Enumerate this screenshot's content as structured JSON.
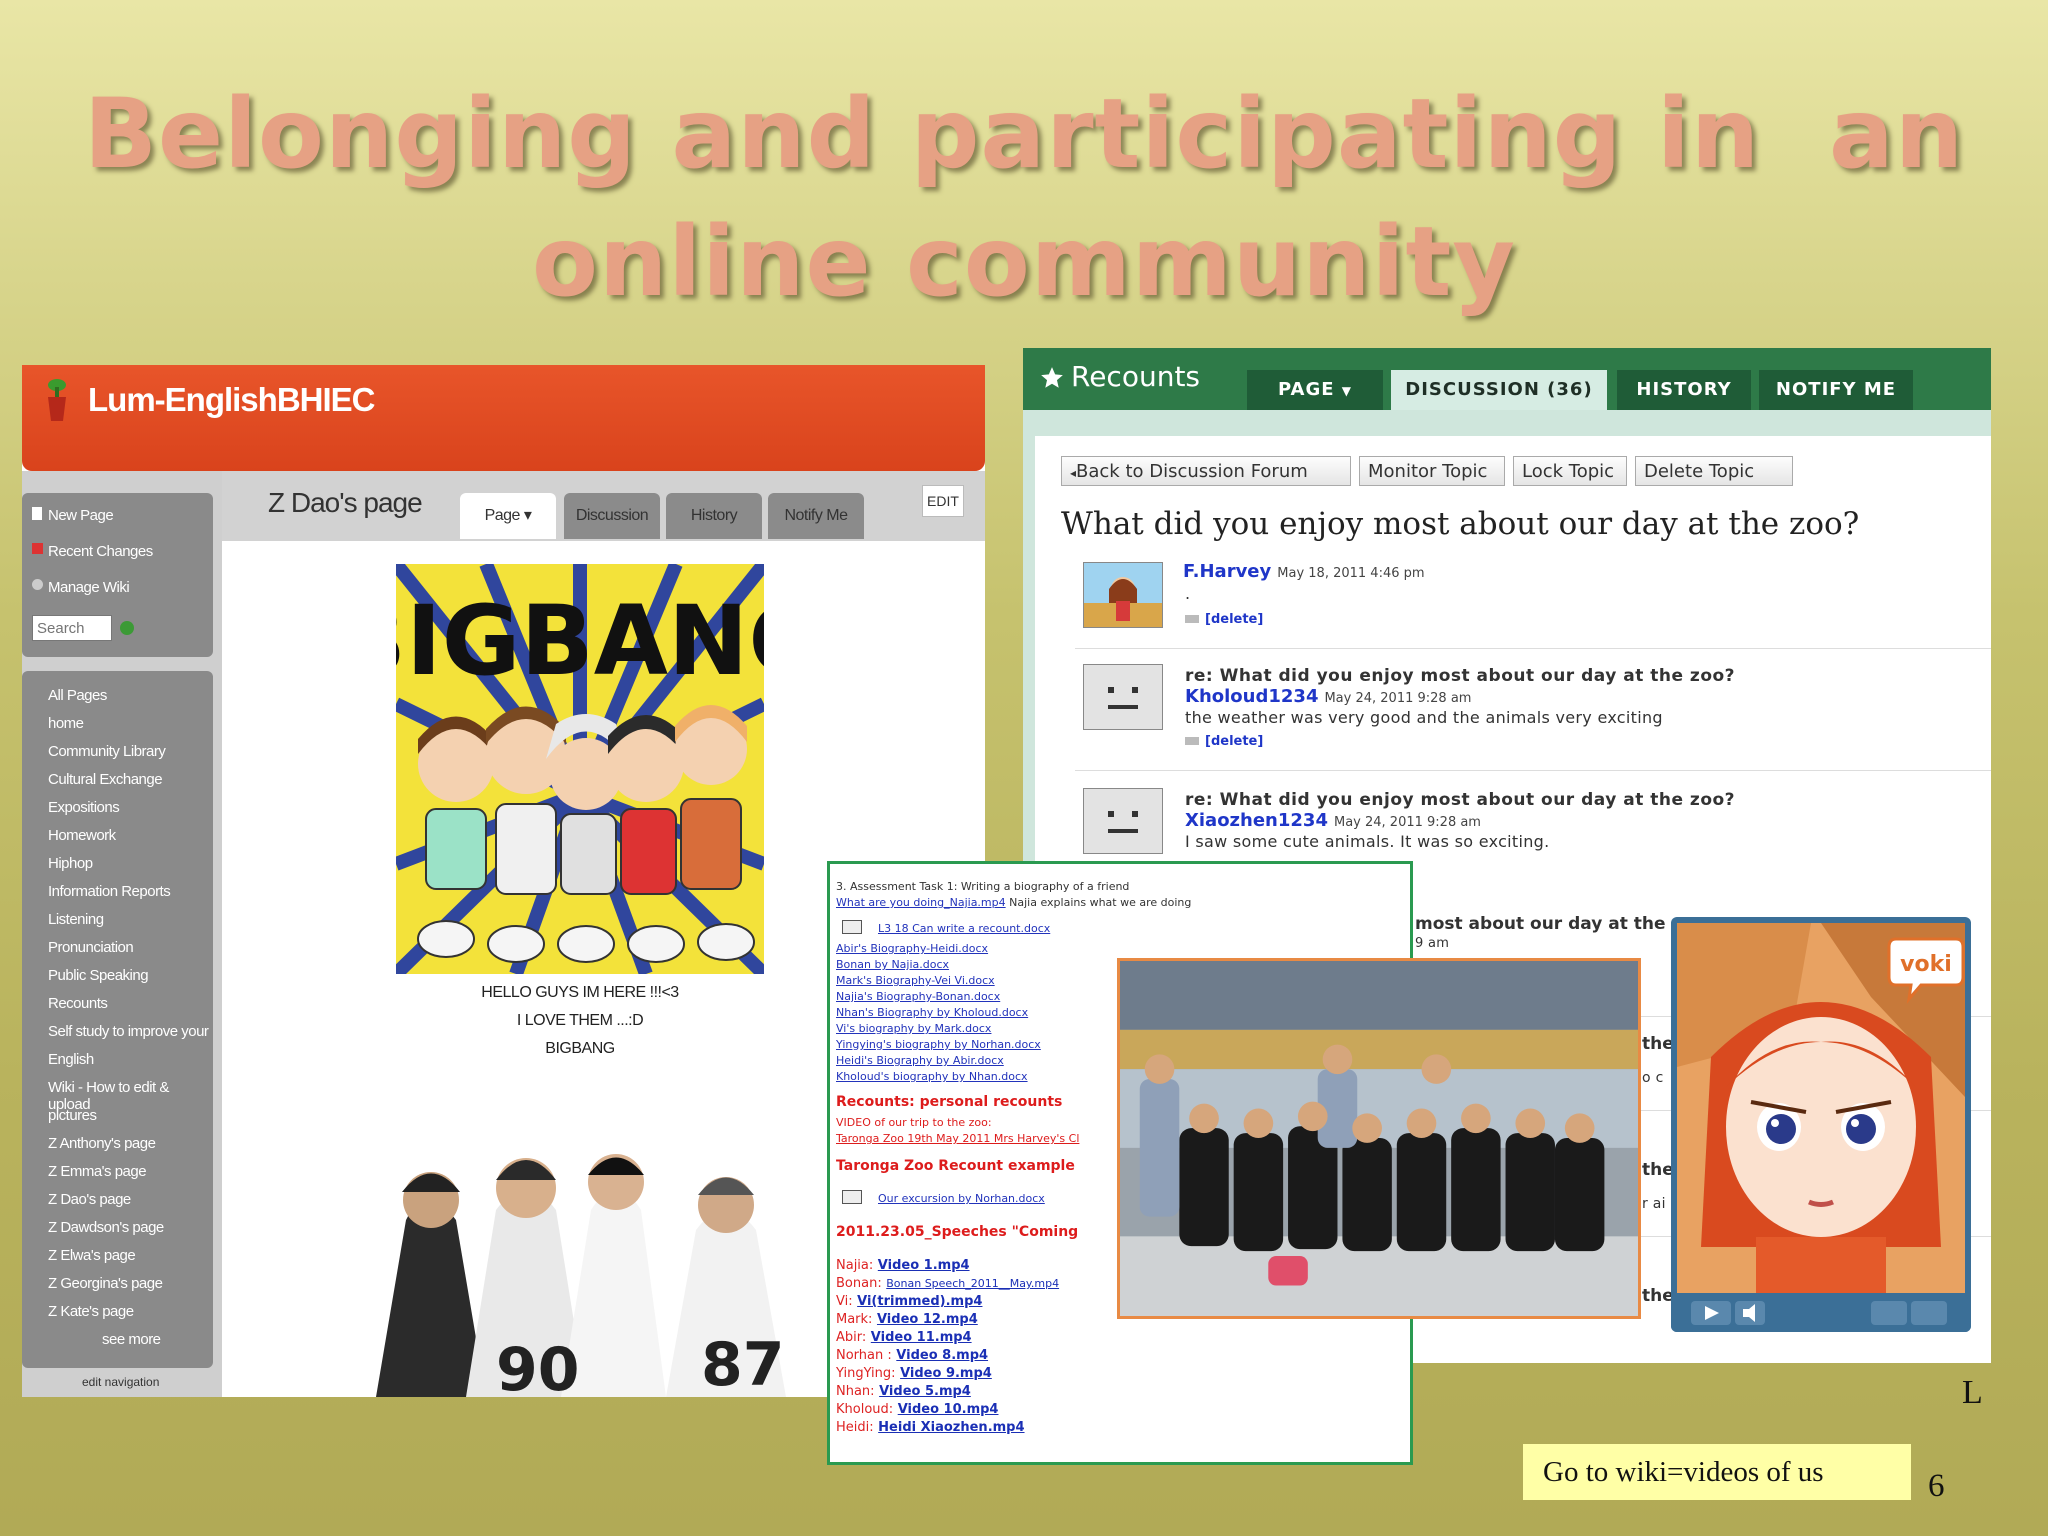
{
  "slide": {
    "title_line1": "Belonging and participating in  an",
    "title_line2": "online community",
    "corner_letter": "L",
    "page_number": "6",
    "cta_text": "Go to wiki=videos of us"
  },
  "wiki": {
    "site_name": "Lum-EnglishBHIEC",
    "tools": [
      "New Page",
      "Recent Changes",
      "Manage Wiki"
    ],
    "search_placeholder": "Search",
    "nav": [
      "All Pages",
      "home",
      "Community Library",
      "Cultural Exchange",
      "Expositions",
      "Homework",
      "Hiphop",
      "Information Reports",
      "Listening",
      "Pronunciation",
      "Public Speaking",
      "Recounts",
      "Self study to improve your",
      "English",
      "Wiki - How to edit & upload",
      "pictures",
      "Z Anthony's page",
      "Z Emma's page",
      "Z Dao's page",
      "Z Dawdson's page",
      "Z Elwa's page",
      "Z Georgina's page",
      "Z Kate's page"
    ],
    "see_more": "see more",
    "edit_navigation": "edit navigation",
    "page_title": "Z Dao's page",
    "tabs": {
      "page": "Page",
      "discussion": "Discussion",
      "history": "History",
      "notify": "Notify Me"
    },
    "edit_label": "EDIT",
    "image_text": "BIGBANG",
    "captions": [
      "HELLO GUYS IM HERE !!!<3",
      "I LOVE THEM ...:D",
      "BIGBANG"
    ]
  },
  "discussion": {
    "page_name": "Recounts",
    "tabs": {
      "page": "PAGE",
      "discussion": "DISCUSSION (36)",
      "history": "HISTORY",
      "notify": "NOTIFY ME"
    },
    "actions": [
      "Back to Discussion Forum",
      "Monitor Topic",
      "Lock Topic",
      "Delete Topic"
    ],
    "question": "What did you enjoy most about our day at the zoo?",
    "delete_label": "[delete]",
    "posts": [
      {
        "author": "F.Harvey",
        "date": "May 18, 2011 4:46 pm",
        "subject": "",
        "text": "."
      },
      {
        "author": "Kholoud1234",
        "date": "May 24, 2011 9:28 am",
        "subject": "re: What did you enjoy most about our day at the zoo?",
        "text": "the weather was very good and the animals very exciting"
      },
      {
        "author": "Xiaozhen1234",
        "date": "May 24, 2011 9:28 am",
        "subject": "re: What did you enjoy most about our day at the zoo?",
        "text": "I saw some cute animals. It was so exciting."
      }
    ],
    "partial_subject": "most about our day at the",
    "partial_time": "9 am",
    "partial_fragments": [
      "the",
      "o c",
      "the",
      "r ai",
      "the"
    ]
  },
  "document": {
    "task_line": "3. Assessment Task 1: Writing a biography of a friend",
    "what_link": "What are you doing_Najia.mp4",
    "what_text": " Najia explains what we are doing",
    "can_write": "L3 18 Can write a recount.docx",
    "doc_links": [
      "Abir's Biography-Heidi.docx",
      "Bonan by Najia.docx",
      "Mark's Biography-Vei Vi.docx",
      "Najia's Biography-Bonan.docx",
      "Nhan's Biography by Kholoud.docx",
      "Vi's biography by Mark.docx",
      "Yingying's biography by Norhan.docx",
      "Heidi's Biography by Abir.docx",
      "Kholoud's biography by Nhan.docx"
    ],
    "recounts_heading": "Recounts: personal recounts",
    "video_line": "VIDEO of our trip to the zoo:",
    "video_link": "Taronga Zoo 19th May 2011 Mrs Harvey's Cl",
    "example_heading": "Taronga Zoo Recount example",
    "excursion_link": "Our excursion by Norhan.docx",
    "speeches_heading": "2011.23.05_Speeches \"Coming",
    "videos": [
      {
        "name": "Najia:",
        "file": "Video 1.mp4"
      },
      {
        "name": "Bonan:",
        "file": "Bonan Speech_2011__May.mp4"
      },
      {
        "name": "Vi:",
        "file": "Vi(trimmed).mp4"
      },
      {
        "name": "Mark:",
        "file": "Video 12.mp4"
      },
      {
        "name": "Abir:",
        "file": "Video 11.mp4"
      },
      {
        "name": "Norhan :",
        "file": "Video 8.mp4"
      },
      {
        "name": "YingYing:",
        "file": "Video 9.mp4"
      },
      {
        "name": "Nhan:",
        "file": "Video 5.mp4"
      },
      {
        "name": "Kholoud:",
        "file": "Video 10.mp4"
      },
      {
        "name": "Heidi:",
        "file": "Heidi Xiaozhen.mp4"
      }
    ]
  },
  "voki": {
    "badge": "voki"
  }
}
